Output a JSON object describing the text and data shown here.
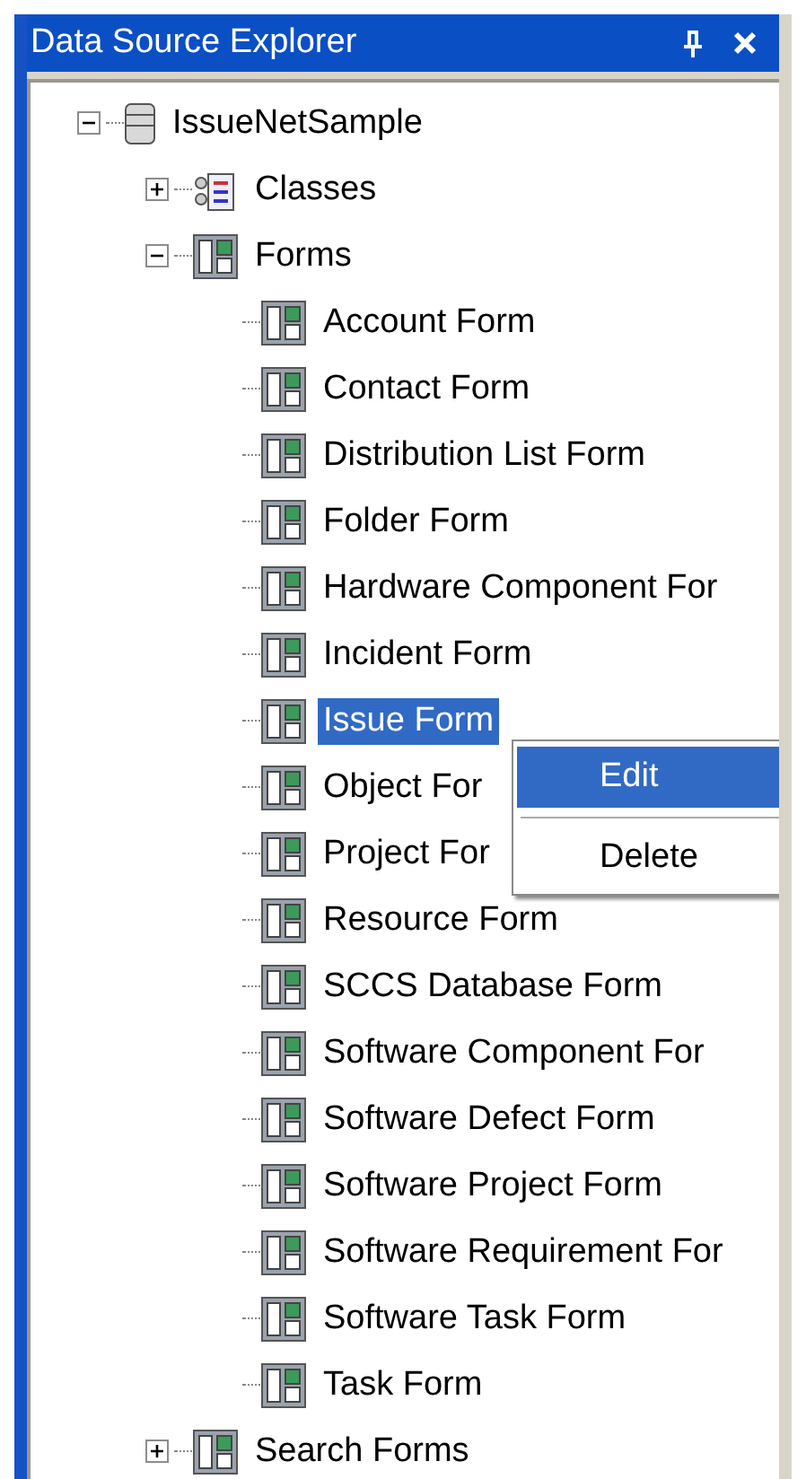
{
  "window": {
    "title": "Data Source Explorer",
    "buttons": [
      {
        "kind": "pin"
      },
      {
        "kind": "close"
      }
    ]
  },
  "tree": [
    {
      "label": "IssueNetSample",
      "kind": "database",
      "expanded": true,
      "selected": false,
      "children": [
        {
          "label": "Classes",
          "kind": "classes",
          "expanded": false,
          "selected": false
        },
        {
          "label": "Forms",
          "kind": "form",
          "expanded": true,
          "selected": false,
          "children": [
            {
              "label": "Account Form",
              "kind": "form",
              "selected": false
            },
            {
              "label": "Contact Form",
              "kind": "form",
              "selected": false
            },
            {
              "label": "Distribution List Form",
              "kind": "form",
              "selected": false
            },
            {
              "label": "Folder Form",
              "kind": "form",
              "selected": false
            },
            {
              "label": "Hardware Component For",
              "kind": "form",
              "selected": false
            },
            {
              "label": "Incident Form",
              "kind": "form",
              "selected": false
            },
            {
              "label": "Issue Form",
              "kind": "form",
              "selected": true
            },
            {
              "label": "Object For",
              "kind": "form",
              "selected": false
            },
            {
              "label": "Project For",
              "kind": "form",
              "selected": false
            },
            {
              "label": "Resource Form",
              "kind": "form",
              "selected": false
            },
            {
              "label": "SCCS Database Form",
              "kind": "form",
              "selected": false
            },
            {
              "label": "Software Component For",
              "kind": "form",
              "selected": false
            },
            {
              "label": "Software Defect Form",
              "kind": "form",
              "selected": false
            },
            {
              "label": "Software Project Form",
              "kind": "form",
              "selected": false
            },
            {
              "label": "Software Requirement For",
              "kind": "form",
              "selected": false
            },
            {
              "label": "Software Task Form",
              "kind": "form",
              "selected": false
            },
            {
              "label": "Task Form",
              "kind": "form",
              "selected": false
            }
          ]
        },
        {
          "label": "Search Forms",
          "kind": "form",
          "expanded": false,
          "selected": false
        }
      ]
    }
  ],
  "context_menu": {
    "items": [
      {
        "kind": "item",
        "label": "Edit",
        "selected": true
      },
      {
        "kind": "separator"
      },
      {
        "kind": "item",
        "label": "Delete",
        "selected": false
      }
    ]
  }
}
